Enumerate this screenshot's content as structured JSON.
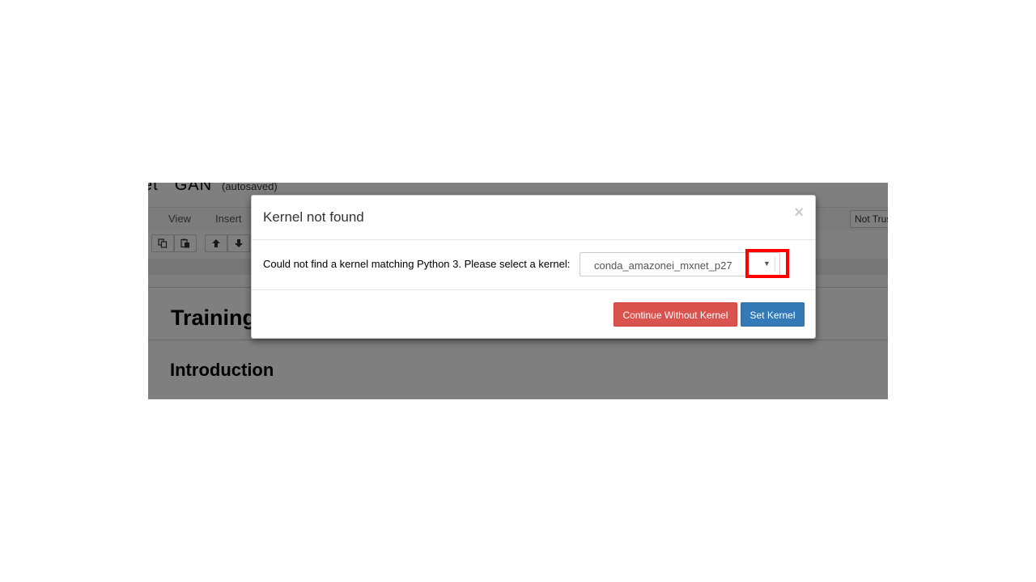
{
  "notebook": {
    "title_tail": "et",
    "name": "GAN",
    "autosave_status": "(autosaved)",
    "menu": {
      "view": "View",
      "insert": "Insert"
    },
    "trusted_badge": "Not Trusted",
    "toolbar": {
      "copy_icon": "copy-icon",
      "paste_icon": "paste-icon",
      "up_icon": "arrow-up-icon",
      "down_icon": "arrow-down-icon"
    },
    "heading1": "Training",
    "heading2": "Introduction"
  },
  "modal": {
    "title": "Kernel not found",
    "close_symbol": "×",
    "message": "Could not find a kernel matching Python 3. Please select a kernel:",
    "kernel_select": {
      "selected": "conda_amazonei_mxnet_p27",
      "arrow": "▼"
    },
    "buttons": {
      "continue": "Continue Without Kernel",
      "set_kernel": "Set Kernel"
    }
  },
  "colors": {
    "danger": "#d9534f",
    "primary": "#337ab7",
    "highlight": "#ff0000"
  }
}
